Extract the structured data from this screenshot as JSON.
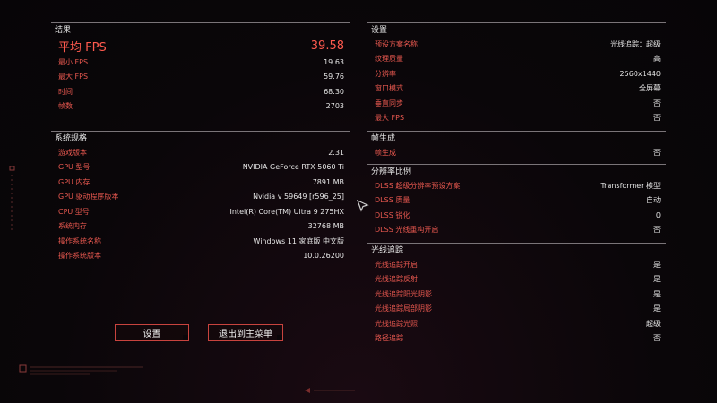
{
  "results": {
    "title": "结果",
    "rows": [
      {
        "label": "平均 FPS",
        "value": "39.58"
      },
      {
        "label": "最小 FPS",
        "value": "19.63"
      },
      {
        "label": "最大 FPS",
        "value": "59.76"
      },
      {
        "label": "时间",
        "value": "68.30"
      },
      {
        "label": "帧数",
        "value": "2703"
      }
    ]
  },
  "system": {
    "title": "系统规格",
    "rows": [
      {
        "label": "游戏版本",
        "value": "2.31"
      },
      {
        "label": "GPU 型号",
        "value": "NVIDIA GeForce RTX 5060 Ti"
      },
      {
        "label": "GPU 内存",
        "value": "7891 MB"
      },
      {
        "label": "GPU 驱动程序版本",
        "value": "Nvidia v 59649 [r596_25]"
      },
      {
        "label": "CPU 型号",
        "value": "Intel(R) Core(TM) Ultra 9 275HX"
      },
      {
        "label": "系统内存",
        "value": "32768 MB"
      },
      {
        "label": "操作系统名称",
        "value": "Windows 11 家庭版 中文版"
      },
      {
        "label": "操作系统版本",
        "value": "10.0.26200"
      }
    ]
  },
  "settings": {
    "title": "设置",
    "rows": [
      {
        "label": "预设方案名称",
        "value": "光线追踪：超级"
      },
      {
        "label": "纹理质量",
        "value": "高"
      },
      {
        "label": "分辨率",
        "value": "2560x1440"
      },
      {
        "label": "窗口模式",
        "value": "全屏幕"
      },
      {
        "label": "垂直同步",
        "value": "否"
      },
      {
        "label": "最大 FPS",
        "value": "否"
      }
    ]
  },
  "frame_gen": {
    "title": "帧生成",
    "rows": [
      {
        "label": "帧生成",
        "value": "否"
      }
    ]
  },
  "resolution_scaling": {
    "title": "分辨率比例",
    "rows": [
      {
        "label": "DLSS 超级分辨率预设方案",
        "value": "Transformer 模型"
      },
      {
        "label": "DLSS 质量",
        "value": "自动"
      },
      {
        "label": "DLSS 锐化",
        "value": "0"
      },
      {
        "label": "DLSS 光线重构开启",
        "value": "否"
      }
    ]
  },
  "ray_tracing": {
    "title": "光线追踪",
    "rows": [
      {
        "label": "光线追踪开启",
        "value": "是"
      },
      {
        "label": "光线追踪反射",
        "value": "是"
      },
      {
        "label": "光线追踪阳光阴影",
        "value": "是"
      },
      {
        "label": "光线追踪局部阴影",
        "value": "是"
      },
      {
        "label": "光线追踪光照",
        "value": "超级"
      },
      {
        "label": "路径追踪",
        "value": "否"
      }
    ]
  },
  "buttons": {
    "settings": "设置",
    "exit": "退出到主菜单"
  },
  "colors": {
    "accent": "#e8584f",
    "highlight": "#ff5a4e",
    "border": "#7a7478"
  }
}
